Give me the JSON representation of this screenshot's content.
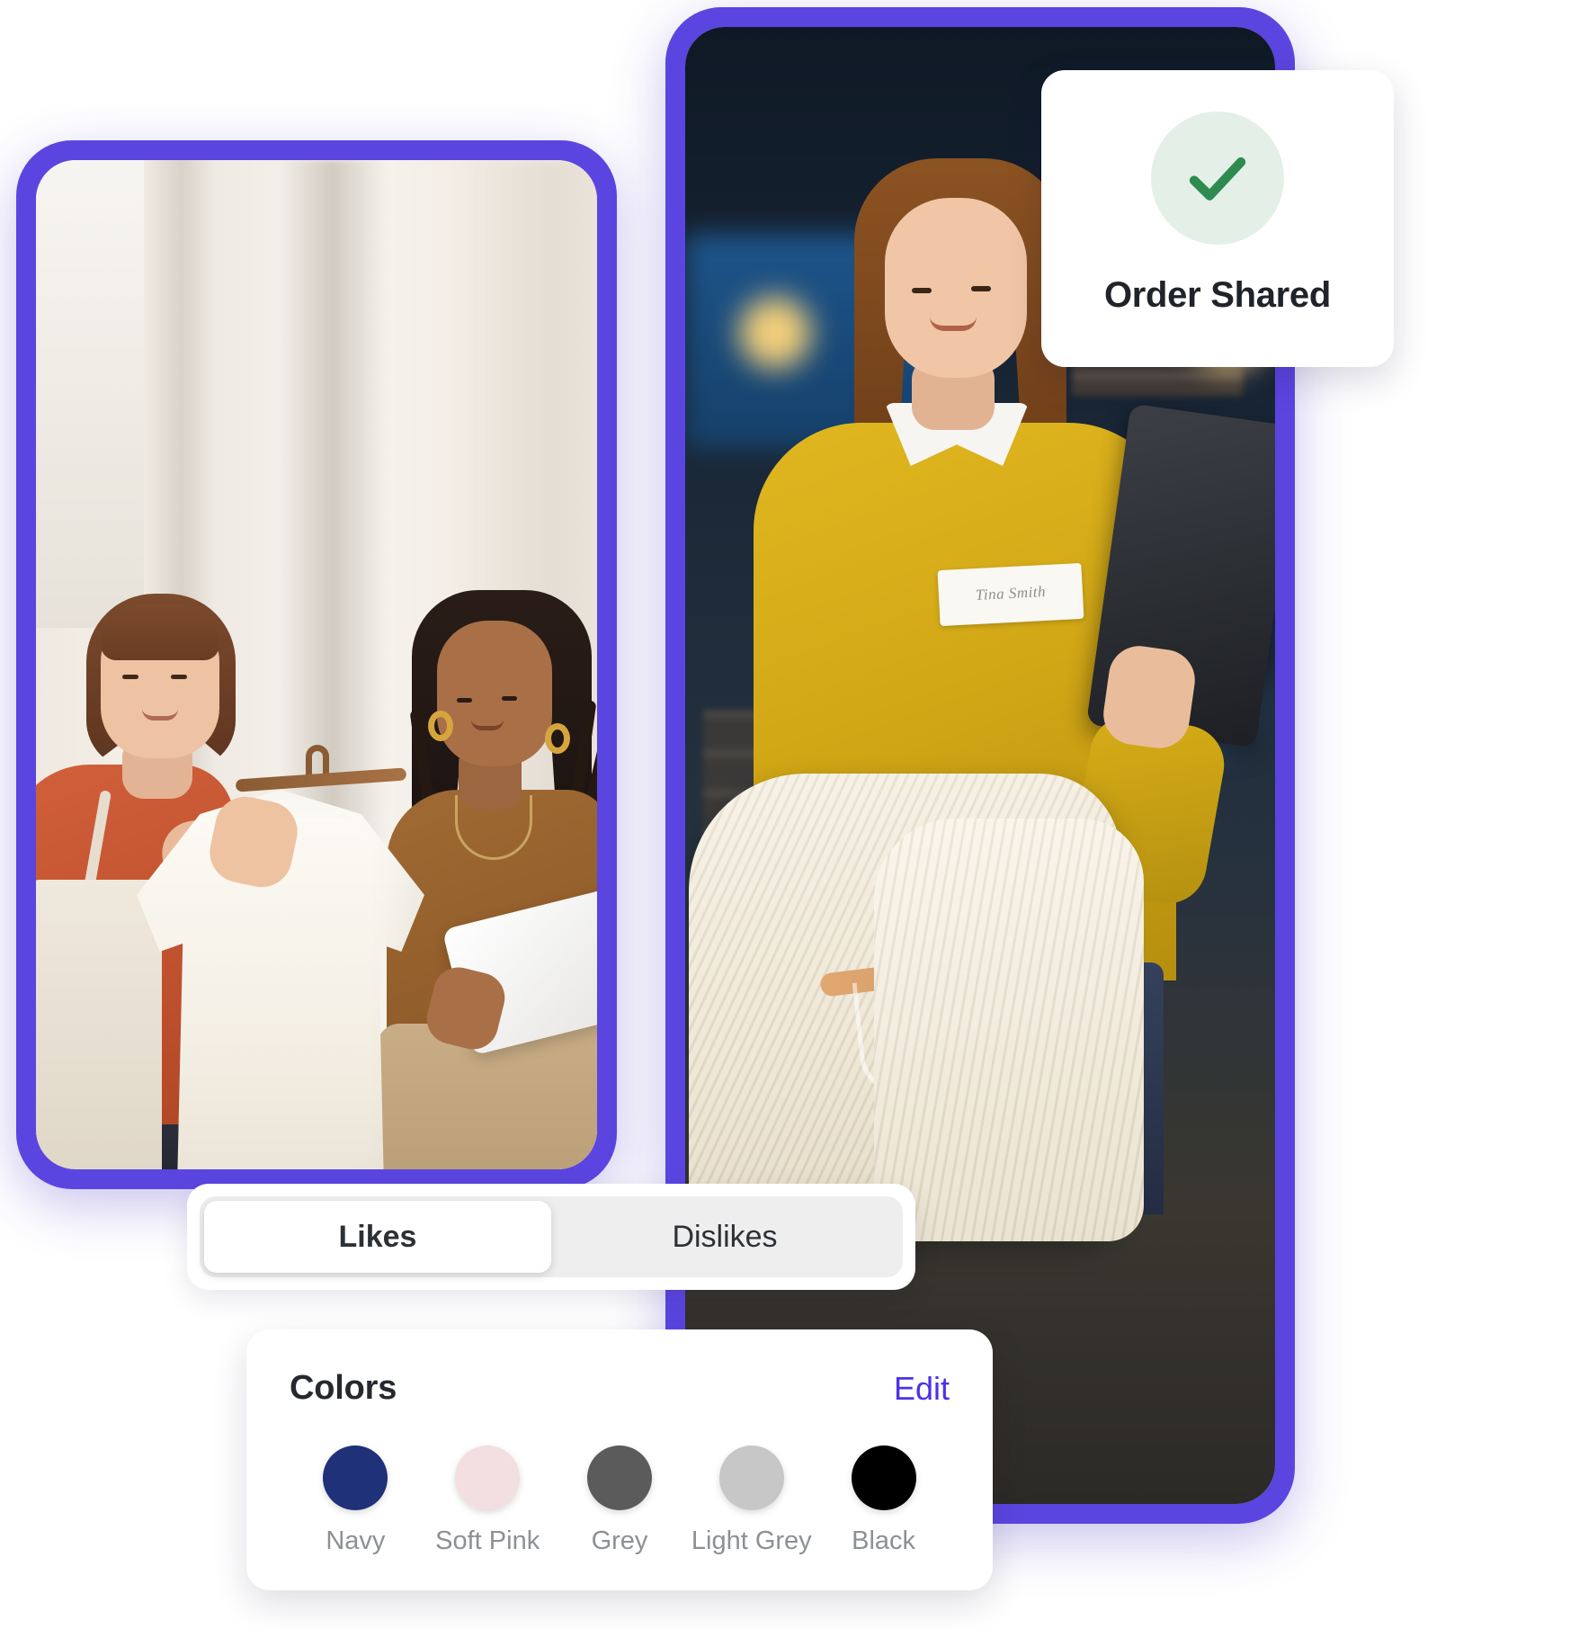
{
  "theme": {
    "frame_purple": "#5b45e0",
    "accent_blue": "#4b32e8",
    "success_green": "#2e8b50",
    "success_bg": "#e4efe7"
  },
  "order_card": {
    "icon": "check-mark-icon",
    "title": "Order Shared"
  },
  "segmented_control": {
    "options": [
      {
        "label": "Likes",
        "selected": true
      },
      {
        "label": "Dislikes",
        "selected": false
      }
    ]
  },
  "colors_card": {
    "title": "Colors",
    "edit_label": "Edit",
    "swatches": [
      {
        "label": "Navy",
        "hex": "#1f3179"
      },
      {
        "label": "Soft Pink",
        "hex": "#f3dfdf"
      },
      {
        "label": "Grey",
        "hex": "#5b5b5b"
      },
      {
        "label": "Light Grey",
        "hex": "#c7c7c7"
      },
      {
        "label": "Black",
        "hex": "#000000"
      }
    ]
  },
  "left_phone": {
    "scene_description": "Two women shopping in a boutique, one holding a white blouse on a wooden hanger, the other holding a tablet"
  },
  "right_phone": {
    "scene_description": "Shop assistant in a yellow sweater holding a cream knit sweater on a hanger and a tablet",
    "name_badge_text": "Tina Smith"
  }
}
